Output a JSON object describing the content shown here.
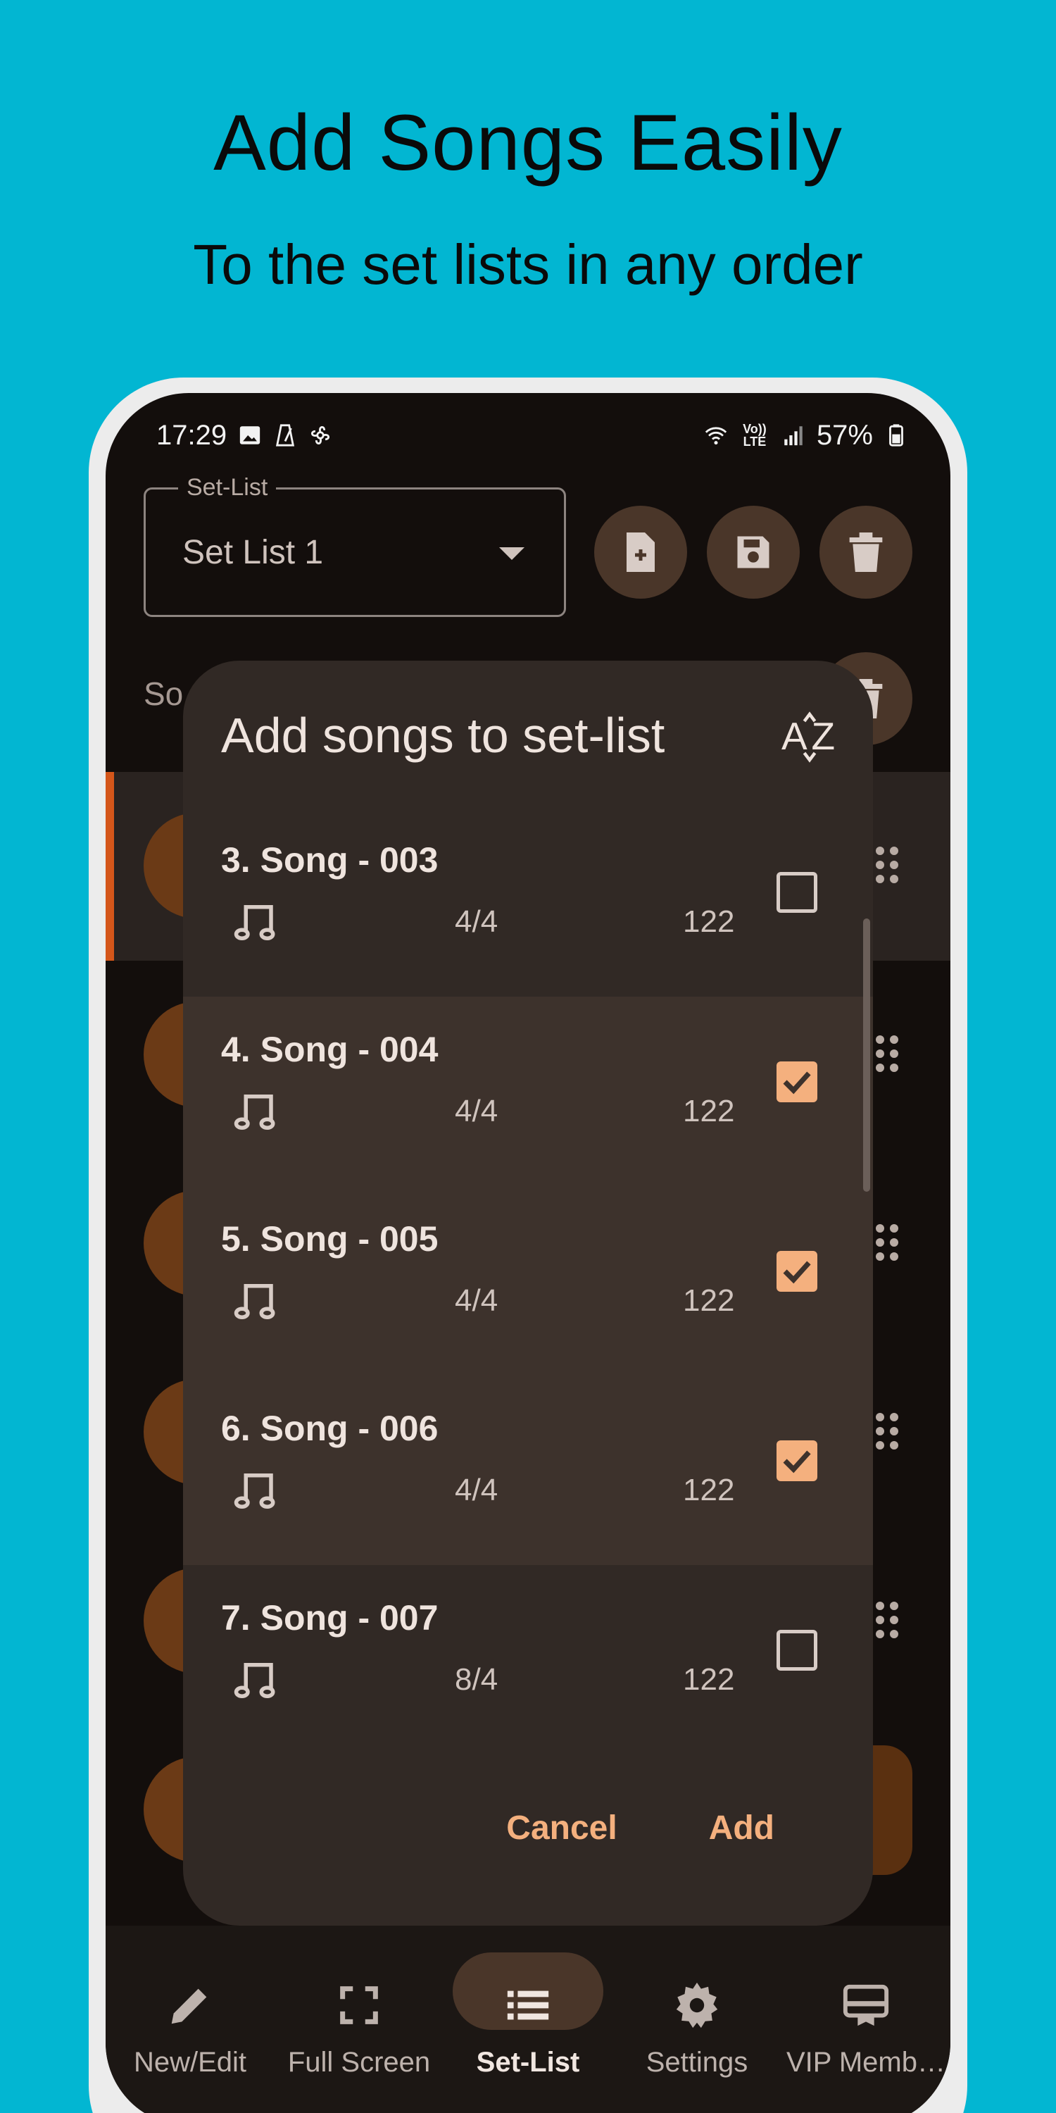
{
  "promo": {
    "headline": "Add Songs Easily",
    "subline": "To the set lists in any order"
  },
  "status_bar": {
    "time": "17:29",
    "battery": "57%",
    "left_icons": [
      "image-icon",
      "metronome-icon",
      "pinwheel-icon"
    ],
    "right_icons": [
      "wifi-icon",
      "volte-icon",
      "signal-icon",
      "battery-icon"
    ],
    "volte_text": "Vo)) LTE"
  },
  "setlist": {
    "legend": "Set-List",
    "value": "Set List 1",
    "actions": [
      "new-file-icon",
      "save-icon",
      "delete-icon"
    ]
  },
  "background": {
    "section_label": "So"
  },
  "dialog": {
    "title": "Add songs to set-list",
    "sort_icon": "sort-az-icon",
    "songs": [
      {
        "name": "3. Song - 003",
        "signature": "4/4",
        "bpm": "122",
        "checked": false
      },
      {
        "name": "4. Song - 004",
        "signature": "4/4",
        "bpm": "122",
        "checked": true
      },
      {
        "name": "5. Song - 005",
        "signature": "4/4",
        "bpm": "122",
        "checked": true
      },
      {
        "name": "6. Song - 006",
        "signature": "4/4",
        "bpm": "122",
        "checked": true
      },
      {
        "name": "7. Song - 007",
        "signature": "8/4",
        "bpm": "122",
        "checked": false
      }
    ],
    "cancel_label": "Cancel",
    "add_label": "Add"
  },
  "nav": {
    "items": [
      {
        "label": "New/Edit",
        "icon": "pencil-icon"
      },
      {
        "label": "Full Screen",
        "icon": "fullscreen-icon"
      },
      {
        "label": "Set-List",
        "icon": "list-icon",
        "active": true
      },
      {
        "label": "Settings",
        "icon": "gear-icon"
      },
      {
        "label": "VIP Memb…",
        "icon": "membership-icon"
      }
    ]
  },
  "colors": {
    "background": "#02b6d2",
    "screen": "#130e0c",
    "dialog": "#312925",
    "accent": "#f4b07e",
    "highlight_bar": "#d4561a"
  }
}
